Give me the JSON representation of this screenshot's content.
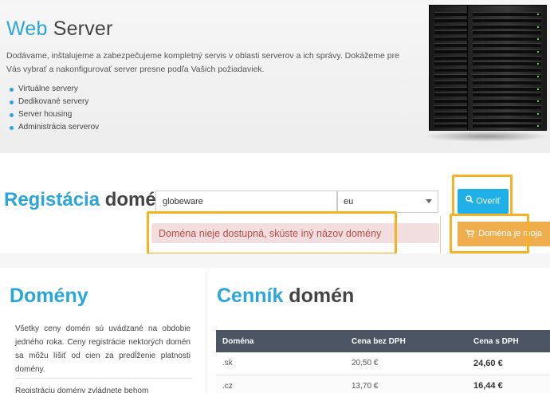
{
  "hero": {
    "title_accent": "Web",
    "title_rest": " Server",
    "description": "Dodávame, inštalujeme a zabezpečujeme kompletný servis v oblasti serverov a ich správy. Dokážeme pre Vás vybrať a nakonfigurovať server presne podľa Vašich požiadaviek.",
    "services": [
      "Virtuálne servery",
      "Dedikované servery",
      "Server housing",
      "Administrácia serverov"
    ]
  },
  "registration": {
    "title_accent": "Registácia",
    "title_rest": " domén",
    "domain_value": "globeware",
    "tld_selected": "eu",
    "verify_label": "Overiť",
    "error_message": "Doména nieje dostupná, skúste iný názov domény",
    "cart_label": "Doména je moja"
  },
  "domains": {
    "title": "Domény",
    "text": "Všetky ceny domén sú uvádzané na obdobie jedného roka. Ceny registrácie nektorých domén sa môžu líšiť od cien za predĺženie platnosti domény.",
    "text2": "Registráciu domény zvládnete behom"
  },
  "pricing": {
    "title_accent": "Cenník",
    "title_rest": " domén",
    "columns": [
      "Doména",
      "Cena bez DPH",
      "Cena s DPH"
    ],
    "rows": [
      {
        "domain": ".sk",
        "price": "20,50 €",
        "price_vat": "24,60 €"
      },
      {
        "domain": ".cz",
        "price": "13,70 €",
        "price_vat": "16,44 €"
      }
    ]
  },
  "colors": {
    "accent": "#2aa6db",
    "verify_button": "#1eb0e6",
    "cart_button": "#f0ad4e",
    "error_bg": "#f2dede",
    "error_text": "#b94a48",
    "highlight": "#f5b324",
    "table_header": "#4b5563"
  },
  "icons": {
    "verify": "search-icon",
    "cart": "shopping-cart-icon",
    "select": "chevron-down-icon"
  }
}
